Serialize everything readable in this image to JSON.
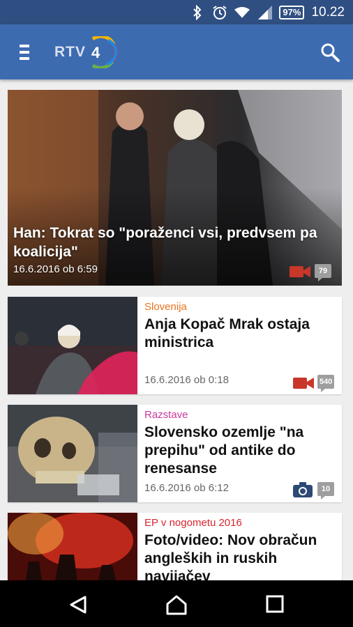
{
  "status_bar": {
    "battery": "97%",
    "time": "10.22"
  },
  "app_bar": {
    "logo_text": "RTV",
    "logo_mark": "4"
  },
  "hero": {
    "title": "Han: Tokrat so \"poraženci vsi, predvsem pa koalicija\"",
    "date": "16.6.2016 ob 6:59",
    "media": "video-icon",
    "comments": "79"
  },
  "articles": [
    {
      "category": "Slovenija",
      "category_color": "#e8731f",
      "title": "Anja Kopač Mrak ostaja ministrica",
      "date": "16.6.2016 ob 0:18",
      "media": "video-icon",
      "comments": "540"
    },
    {
      "category": "Razstave",
      "category_color": "#c83a9e",
      "title": "Slovensko ozemlje \"na prepihu\" od antike do renesanse",
      "date": "16.6.2016 ob 6:12",
      "media": "camera-icon",
      "comments": "10"
    },
    {
      "category": "EP v nogometu 2016",
      "category_color": "#d8262f",
      "title": "Foto/video: Nov obračun angleških in ruskih navijačev",
      "date": "",
      "media": "",
      "comments": ""
    }
  ],
  "colors": {
    "status_bar": "#2f4f82",
    "app_bar": "#3d6bb0",
    "video_icon": "#c9372a",
    "camera_icon": "#2c4a73"
  }
}
